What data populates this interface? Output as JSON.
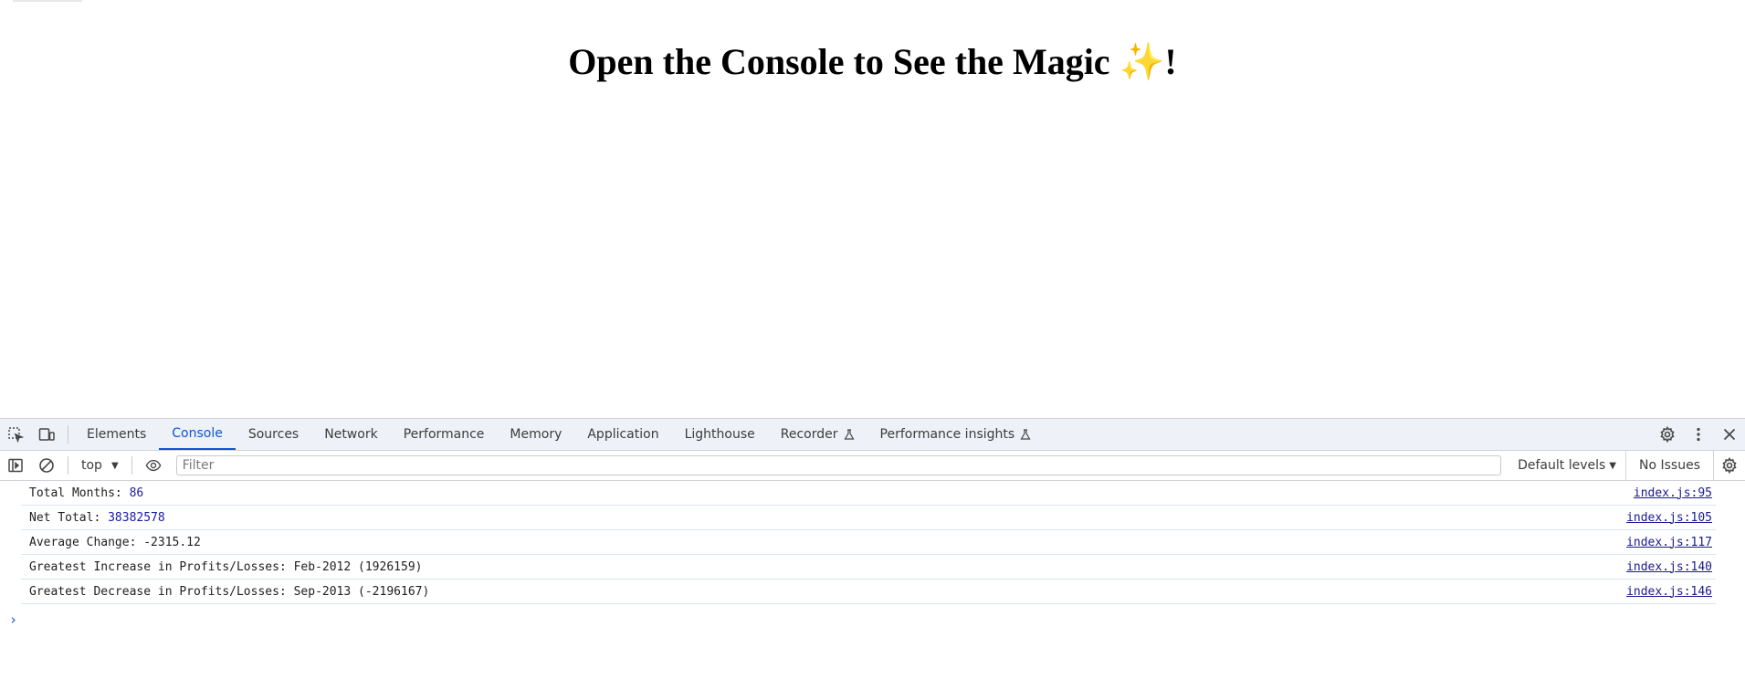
{
  "page": {
    "heading": "Open the Console to See the Magic ✨!"
  },
  "devtools": {
    "tabs": [
      {
        "label": "Elements",
        "active": false
      },
      {
        "label": "Console",
        "active": true
      },
      {
        "label": "Sources",
        "active": false
      },
      {
        "label": "Network",
        "active": false
      },
      {
        "label": "Performance",
        "active": false
      },
      {
        "label": "Memory",
        "active": false
      },
      {
        "label": "Application",
        "active": false
      },
      {
        "label": "Lighthouse",
        "active": false
      },
      {
        "label": "Recorder",
        "active": false,
        "experimental": true
      },
      {
        "label": "Performance insights",
        "active": false,
        "experimental": true
      }
    ],
    "toolbar": {
      "context": "top",
      "filter_placeholder": "Filter",
      "levels": "Default levels",
      "issues": "No Issues"
    },
    "console": {
      "lines": [
        {
          "label": "Total Months: ",
          "value": "86",
          "numeric": true,
          "source": "index.js:95"
        },
        {
          "label": "Net Total: ",
          "value": "38382578",
          "numeric": true,
          "source": "index.js:105"
        },
        {
          "label": "Average Change: -2315.12",
          "value": "",
          "numeric": false,
          "source": "index.js:117"
        },
        {
          "label": "Greatest Increase in Profits/Losses: Feb-2012 (1926159)",
          "value": "",
          "numeric": false,
          "source": "index.js:140"
        },
        {
          "label": "Greatest Decrease in Profits/Losses: Sep-2013 (-2196167)",
          "value": "",
          "numeric": false,
          "source": "index.js:146"
        }
      ],
      "prompt": "›"
    },
    "colors": {
      "accent": "#0b57d0",
      "number": "#1a1aa6",
      "tabbar_bg": "#eef1f7"
    }
  }
}
